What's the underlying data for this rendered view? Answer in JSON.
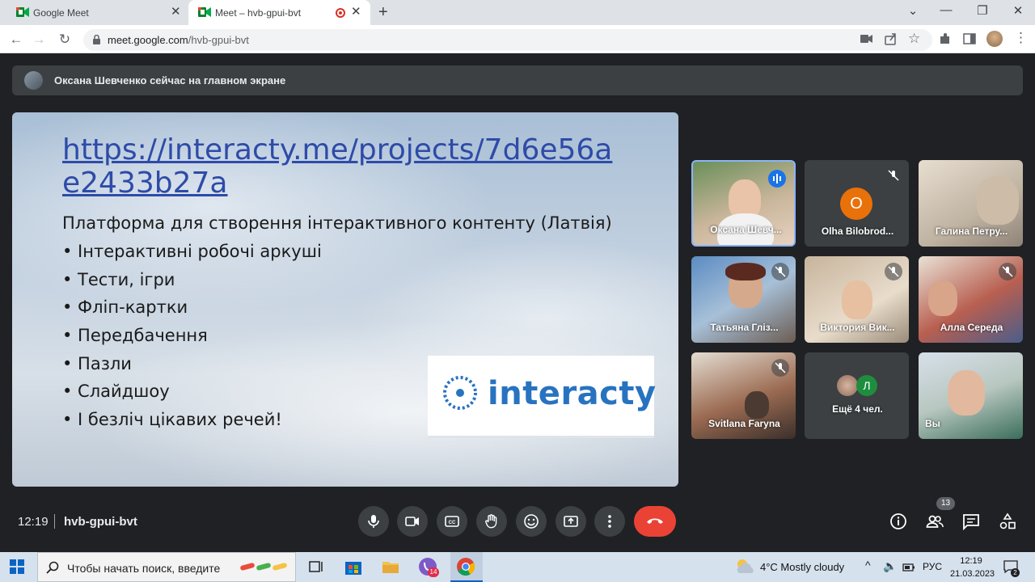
{
  "browser": {
    "tabs": [
      {
        "title": "Google Meet"
      },
      {
        "title": "Meet – hvb-gpui-bvt"
      }
    ],
    "address": {
      "host": "meet.google.com",
      "path": "/hvb-gpui-bvt"
    }
  },
  "meet": {
    "banner": "Оксана Шевченко сейчас на главном экране",
    "slide": {
      "link": "https://interacty.me/projects/7d6e56ae2433b27a",
      "subtitle": "Платформа для створення інтерактивного контенту (Латвія)",
      "bullets": [
        "• Інтерактивні робочі аркуші",
        "• Тести, ігри",
        "• Фліп-картки",
        "• Передбачення",
        "• Пазли",
        "• Слайдшоу",
        "• І безліч цікавих речей!"
      ],
      "logo_text": "interacty"
    },
    "participants": [
      {
        "name": "Оксана Шевч..."
      },
      {
        "name": "Olha Bilobrod...",
        "letter": "O"
      },
      {
        "name": "Галина Петру..."
      },
      {
        "name": "Татьяна Гліз..."
      },
      {
        "name": "Виктория Вик..."
      },
      {
        "name": "Алла Середа"
      },
      {
        "name": "Svitlana Faryna"
      },
      {
        "name": "Ещё 4 чел.",
        "letter": "Л"
      },
      {
        "name": "Вы"
      }
    ],
    "time": "12:19",
    "meeting_code": "hvb-gpui-bvt",
    "people_count": "13"
  },
  "taskbar": {
    "search_placeholder": "Чтобы начать поиск, введите",
    "viber_badge": "14",
    "weather": "4°C  Mostly cloudy",
    "lang": "РУС",
    "time": "12:19",
    "date": "21.03.2023",
    "notifications": "2"
  },
  "colors": {
    "accent": "#1a73e8",
    "leave": "#ea4335",
    "meet_bg": "#202124"
  }
}
